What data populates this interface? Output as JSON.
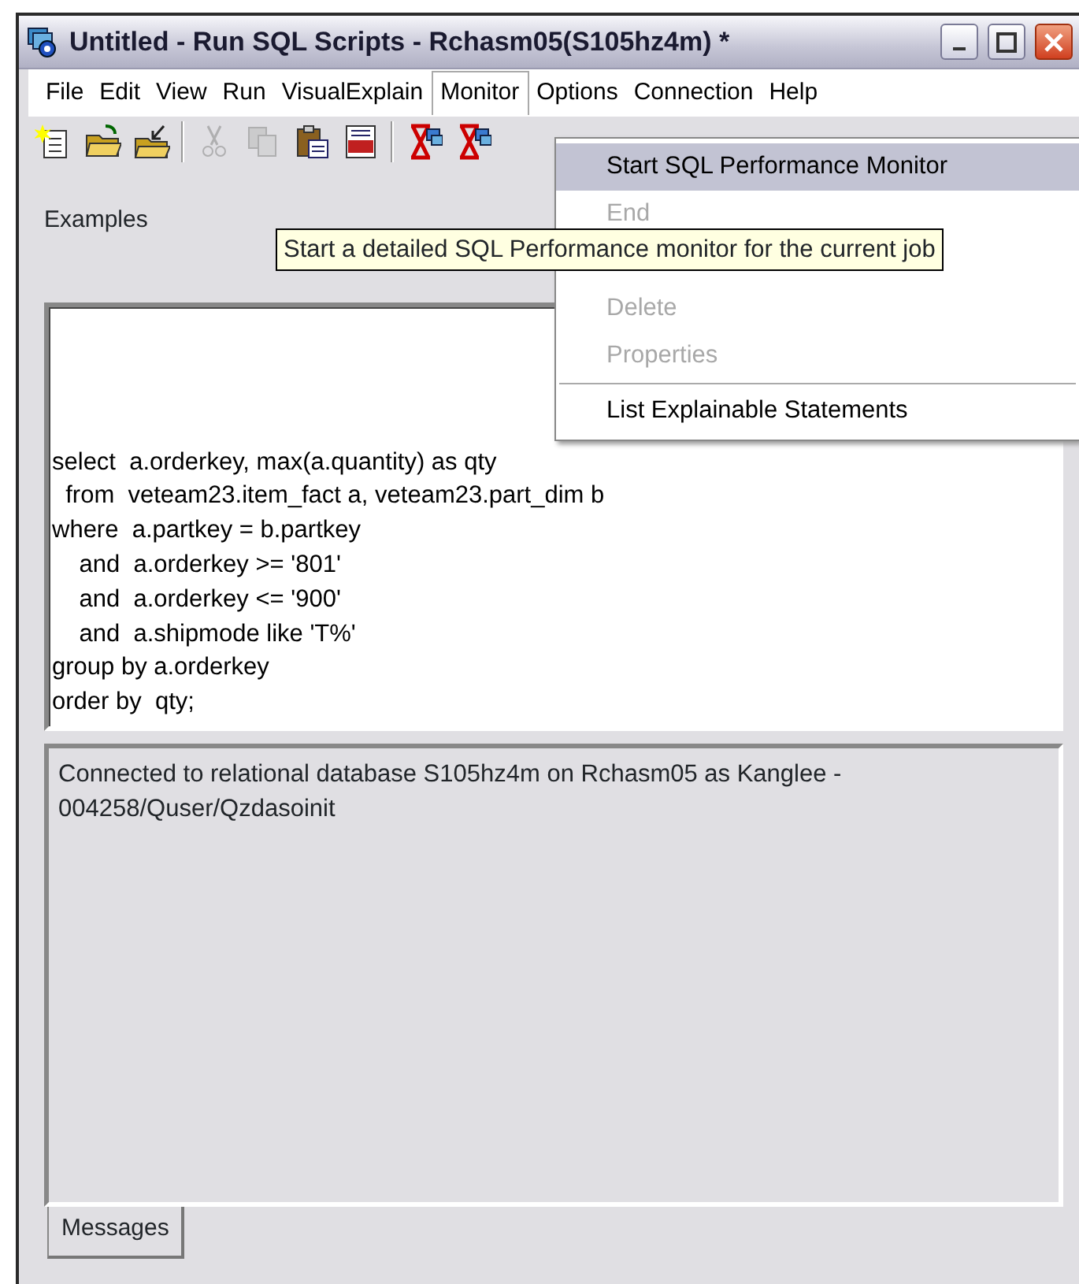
{
  "window": {
    "title": "Untitled - Run SQL Scripts - Rchasm05(S105hz4m) *"
  },
  "menu_bar": [
    {
      "label": "File",
      "selected": false
    },
    {
      "label": "Edit",
      "selected": false
    },
    {
      "label": "View",
      "selected": false
    },
    {
      "label": "Run",
      "selected": false
    },
    {
      "label": "VisualExplain",
      "selected": false
    },
    {
      "label": "Monitor",
      "selected": true
    },
    {
      "label": "Options",
      "selected": false
    },
    {
      "label": "Connection",
      "selected": false
    },
    {
      "label": "Help",
      "selected": false
    }
  ],
  "toolbar": [
    {
      "kind": "new",
      "disabled": false
    },
    {
      "kind": "open",
      "disabled": false
    },
    {
      "kind": "import",
      "disabled": false
    },
    {
      "kind": "separator"
    },
    {
      "kind": "cut",
      "disabled": true
    },
    {
      "kind": "copy",
      "disabled": true
    },
    {
      "kind": "paste",
      "disabled": false
    },
    {
      "kind": "sql",
      "disabled": false
    },
    {
      "kind": "separator"
    },
    {
      "kind": "hourglass",
      "disabled": false
    },
    {
      "kind": "hourglass",
      "disabled": false
    }
  ],
  "examples": {
    "label": "Examples"
  },
  "monitor_menu": [
    {
      "kind": "item",
      "label": "Start SQL Performance Monitor",
      "selected": true,
      "disabled": false
    },
    {
      "kind": "item",
      "label": "End",
      "selected": false,
      "disabled": true
    },
    {
      "kind": "hidden"
    },
    {
      "kind": "item",
      "label": "Delete",
      "selected": false,
      "disabled": true
    },
    {
      "kind": "item",
      "label": "Properties",
      "selected": false,
      "disabled": true
    },
    {
      "kind": "separator"
    },
    {
      "kind": "item",
      "label": "List Explainable Statements",
      "selected": false,
      "disabled": false
    }
  ],
  "tooltip": "Start a detailed SQL Performance monitor for the current job",
  "editor": {
    "lines": [
      "select  a.orderkey, max(a.quantity) as qty",
      "  from  veteam23.item_fact a, veteam23.part_dim b",
      "where  a.partkey = b.partkey",
      "    and  a.orderkey >= '801'",
      "    and  a.orderkey <= '900'",
      "    and  a.shipmode like 'T%'",
      "group by a.orderkey",
      "order by  qty;"
    ]
  },
  "messages": {
    "text": "Connected to relational database S105hz4m on Rchasm05 as Kanglee - 004258/Quser/Qzdasoinit"
  },
  "bottom_tabs": [
    {
      "label": "Messages",
      "selected": true
    }
  ]
}
